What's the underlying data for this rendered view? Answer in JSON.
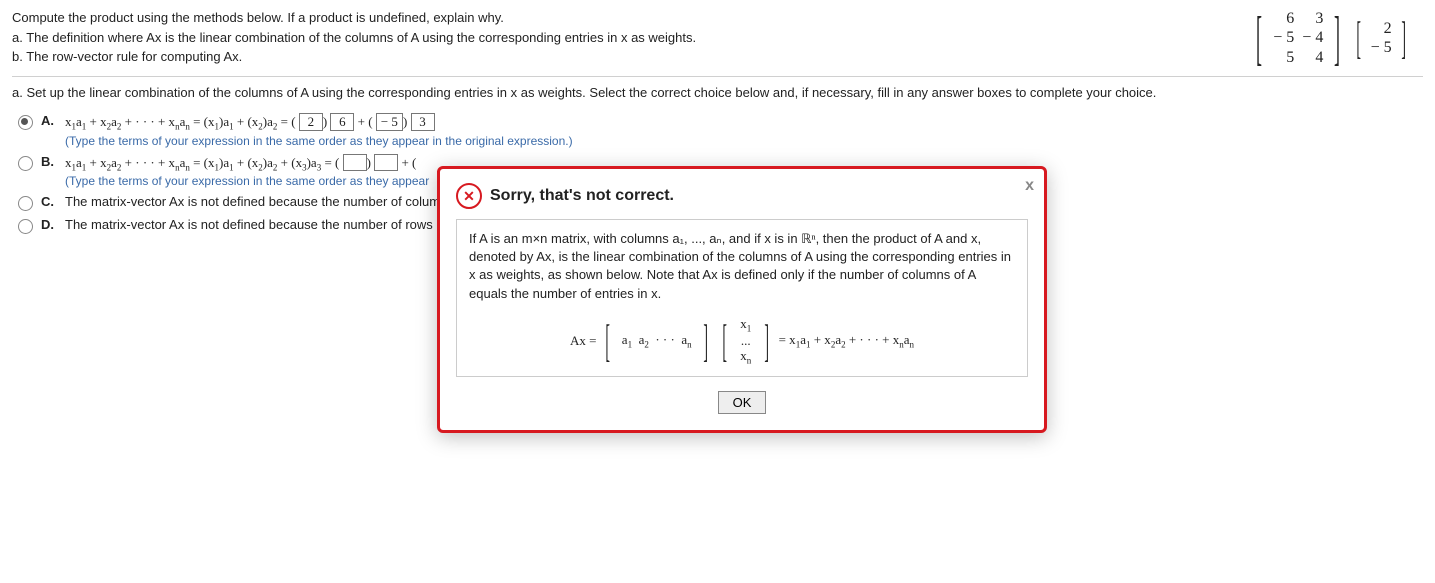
{
  "question": {
    "intro": "Compute the product using the methods below. If a product is undefined, explain why.",
    "a": "a. The definition where Ax is the linear combination of the columns of A using the corresponding entries in x as weights.",
    "b": "b. The row-vector rule for computing Ax."
  },
  "matrixA": {
    "r1c1": "6",
    "r1c2": "3",
    "r2c1": "− 5",
    "r2c2": "− 4",
    "r3c1": "5",
    "r3c2": "4"
  },
  "vectorX": {
    "r1": "2",
    "r2": "− 5"
  },
  "partA_prompt": "a. Set up the linear combination of the columns of A using the corresponding entries in x as weights. Select the correct choice below and, if necessary, fill in any answer boxes to complete your choice.",
  "choices": {
    "A": {
      "letter": "A.",
      "expr_left": "x₁a₁ + x₂a₂ + · · · + xₙaₙ = (x₁)a₁ + (x₂)a₂ = (",
      "ans1": "2",
      "mid1": ")",
      "v1": "6",
      "plus": " + (",
      "ans2": " − 5",
      "mid2": ")",
      "v2": "3",
      "hint": "(Type the terms of your expression in the same order as they appear in the original expression.)"
    },
    "B": {
      "letter": "B.",
      "expr": "x₁a₁ + x₂a₂ + · · · + xₙaₙ = (x₁)a₁ + (x₂)a₂ + (x₃)a₃ = (",
      "blank": " ",
      "mid": ")",
      "plus": " + (",
      "hint": "(Type the terms of your expression in the same order as they appear"
    },
    "C": {
      "letter": "C.",
      "text": "The matrix-vector Ax is not defined because the number of columns"
    },
    "D": {
      "letter": "D.",
      "text": "The matrix-vector Ax is not defined because the number of rows in m"
    }
  },
  "modal": {
    "title": "Sorry, that's not correct.",
    "body_p1": "If A is an m×n matrix, with columns a₁, ..., aₙ, and if x is in ",
    "body_rn": "ℝⁿ",
    "body_p2": ", then the product of A and x, denoted by Ax, is the linear combination of the columns of A using the corresponding entries in x as weights, as shown below. Note that Ax is defined only if the number of columns of A equals the number of entries in x.",
    "ax": "Ax =",
    "arow": "a₁  a₂  · · ·  aₙ",
    "x1": "x₁",
    "dots": "...",
    "xn": "xₙ",
    "eq": "= x₁a₁ + x₂a₂ + · · · + xₙaₙ",
    "ok": "OK"
  }
}
